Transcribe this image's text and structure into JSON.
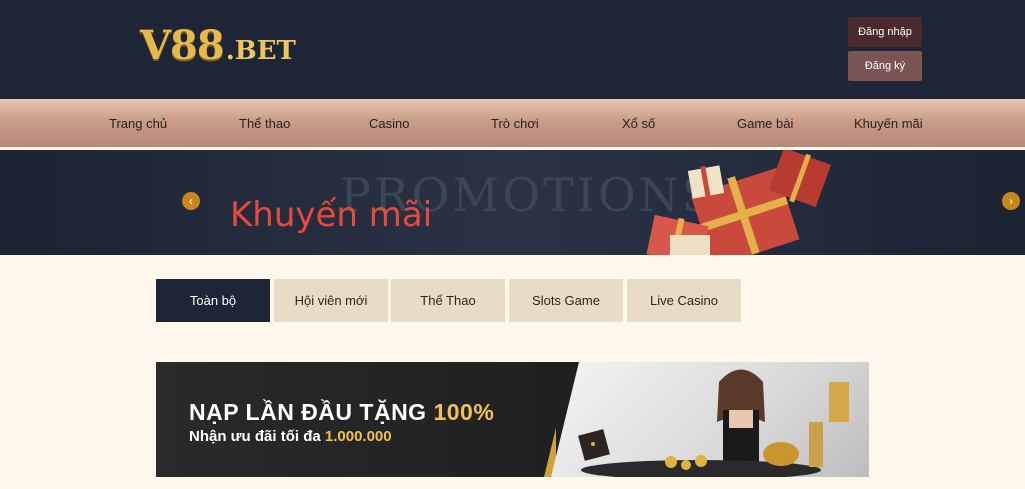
{
  "brand": {
    "logo_main": "V88",
    "logo_suffix": ".BET"
  },
  "auth": {
    "login_label": "Đăng nhập",
    "register_label": "Đăng ký"
  },
  "nav": {
    "items": [
      {
        "label": "Trang chủ"
      },
      {
        "label": "Thể thao"
      },
      {
        "label": "Casino"
      },
      {
        "label": "Trò chơi"
      },
      {
        "label": "Xổ số"
      },
      {
        "label": "Game bài"
      },
      {
        "label": "Khuyến mãi"
      }
    ]
  },
  "banner": {
    "watermark": "PROMOTIONS",
    "title": "Khuyến mãi",
    "prev_icon": "chevron-left-icon",
    "next_icon": "chevron-right-icon"
  },
  "tabs": {
    "items": [
      {
        "label": "Toàn bộ",
        "active": true
      },
      {
        "label": "Hội viên mới",
        "active": false
      },
      {
        "label": "Thể Thao",
        "active": false
      },
      {
        "label": "Slots Game",
        "active": false
      },
      {
        "label": "Live Casino",
        "active": false
      }
    ]
  },
  "promo": {
    "headline_main": "NẠP LẦN ĐẦU TẶNG ",
    "headline_highlight": "100%",
    "sub_main": "Nhận ưu đãi tối đa ",
    "sub_highlight": "1.000.000"
  },
  "colors": {
    "header_bg": "#1d2536",
    "accent_gold": "#f2c14e",
    "banner_title_red": "#e8493c",
    "tab_active_bg": "#1d2536",
    "tab_bg": "#e8dcc6"
  }
}
